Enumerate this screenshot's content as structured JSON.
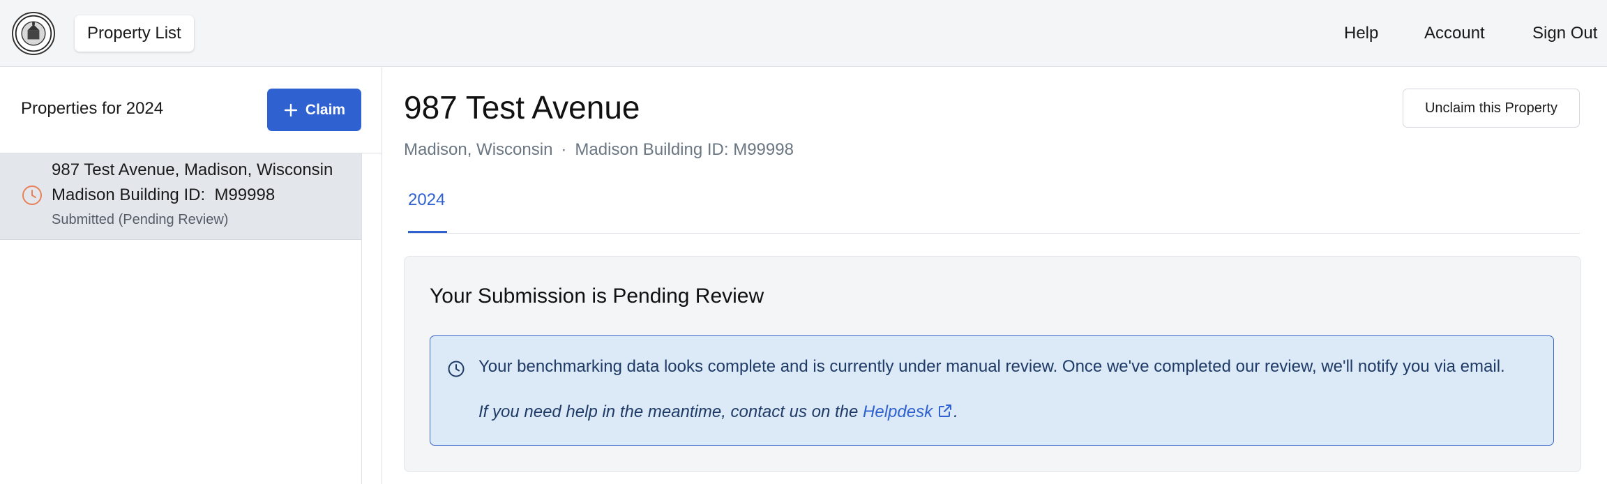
{
  "header": {
    "logo_icon": "city-seal-icon",
    "property_list_label": "Property List",
    "nav": {
      "help": "Help",
      "account": "Account",
      "sign_out": "Sign Out"
    }
  },
  "sidebar": {
    "title": "Properties for 2024",
    "claim_label": "Claim",
    "claim_icon": "plus-icon",
    "items": [
      {
        "address": "987 Test Avenue, Madison, Wisconsin",
        "building_id": "Madison Building ID:  M99998",
        "status": "Submitted (Pending Review)",
        "status_icon": "clock-icon",
        "status_color": "#e8815a"
      }
    ]
  },
  "main": {
    "title": "987 Test Avenue",
    "location": "Madison, Wisconsin",
    "separator": "·",
    "building_id": "Madison Building ID: M99998",
    "unclaim_label": "Unclaim this Property",
    "tabs": [
      {
        "label": "2024",
        "active": true
      }
    ],
    "card": {
      "title": "Your Submission is Pending Review",
      "notice": {
        "icon": "clock-icon",
        "message": "Your benchmarking data looks complete and is currently under manual review. Once we've completed our review, we'll notify you via email.",
        "help_prefix": "If you need help in the meantime, contact us on the ",
        "help_link": "Helpdesk",
        "help_link_icon": "external-link-icon",
        "help_suffix": "."
      }
    }
  },
  "colors": {
    "accent": "#2f62d0",
    "notice_bg": "#dce9f6",
    "notice_border": "#3767c8",
    "pending": "#e8815a"
  }
}
